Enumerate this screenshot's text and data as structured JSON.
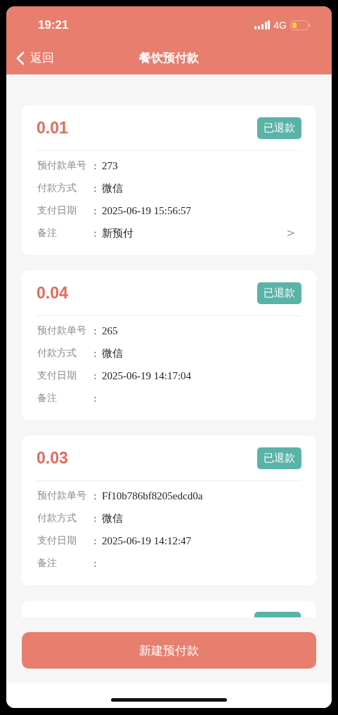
{
  "status_bar": {
    "time": "19:21",
    "network": "4G"
  },
  "nav": {
    "back": "返回",
    "title": "餐饮预付款"
  },
  "cards": [
    {
      "kind": "full",
      "amount": "0.01",
      "status": "已退款",
      "fields": [
        {
          "label": "预付款单号",
          "colon": ":",
          "value": "273"
        },
        {
          "label": "付款方式",
          "colon": ":",
          "value": "微信"
        },
        {
          "label": "支付日期",
          "colon": ":",
          "value": "2025-06-19 15:56:57"
        },
        {
          "label": "备注",
          "colon": ":",
          "value": "新预付",
          "arrow": ">"
        }
      ]
    },
    {
      "kind": "full",
      "amount": "0.04",
      "status": "已退款",
      "fields": [
        {
          "label": "预付款单号",
          "colon": ":",
          "value": "265"
        },
        {
          "label": "付款方式",
          "colon": ":",
          "value": "微信"
        },
        {
          "label": "支付日期",
          "colon": ":",
          "value": "2025-06-19 14:17:04"
        },
        {
          "label": "备注",
          "colon": ":"
        }
      ]
    },
    {
      "kind": "full",
      "amount": "0.03",
      "status": "已退款",
      "fields": [
        {
          "label": "预付款单号",
          "colon": ":",
          "value": "Ff10b786bf8205edcd0a"
        },
        {
          "label": "付款方式",
          "colon": ":",
          "value": "微信"
        },
        {
          "label": "支付日期",
          "colon": ":",
          "value": "2025-06-19 14:12:47"
        },
        {
          "label": "备注",
          "colon": ":"
        }
      ]
    },
    {
      "kind": "cut_off"
    }
  ],
  "button": "新建预付款"
}
